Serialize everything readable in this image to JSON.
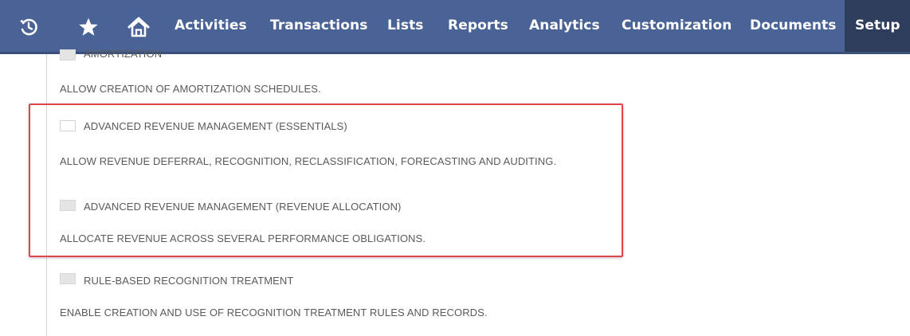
{
  "navbar": {
    "icons": [
      "recent-history-icon",
      "star-icon",
      "home-icon"
    ],
    "items": [
      "Activities",
      "Transactions",
      "Lists",
      "Reports",
      "Analytics",
      "Customization",
      "Documents",
      "Setup"
    ],
    "active_item": "Setup",
    "colors": {
      "background": "#4a6396",
      "active_background": "#2e3d5c",
      "text": "#ffffff"
    }
  },
  "features": [
    {
      "label": "AMORTIZATION",
      "description": "ALLOW CREATION OF AMORTIZATION SCHEDULES.",
      "checked": false,
      "enabled": false
    },
    {
      "label": "ADVANCED REVENUE MANAGEMENT (ESSENTIALS)",
      "description": "ALLOW REVENUE DEFERRAL, RECOGNITION, RECLASSIFICATION, FORECASTING AND AUDITING.",
      "checked": false,
      "enabled": true
    },
    {
      "label": "ADVANCED REVENUE MANAGEMENT (REVENUE ALLOCATION)",
      "description": "ALLOCATE REVENUE ACROSS SEVERAL PERFORMANCE OBLIGATIONS.",
      "checked": false,
      "enabled": false
    },
    {
      "label": "RULE-BASED RECOGNITION TREATMENT",
      "description": "ENABLE CREATION AND USE OF RECOGNITION TREATMENT RULES AND RECORDS.",
      "checked": false,
      "enabled": false
    }
  ],
  "highlight": {
    "color": "#e0444c"
  }
}
